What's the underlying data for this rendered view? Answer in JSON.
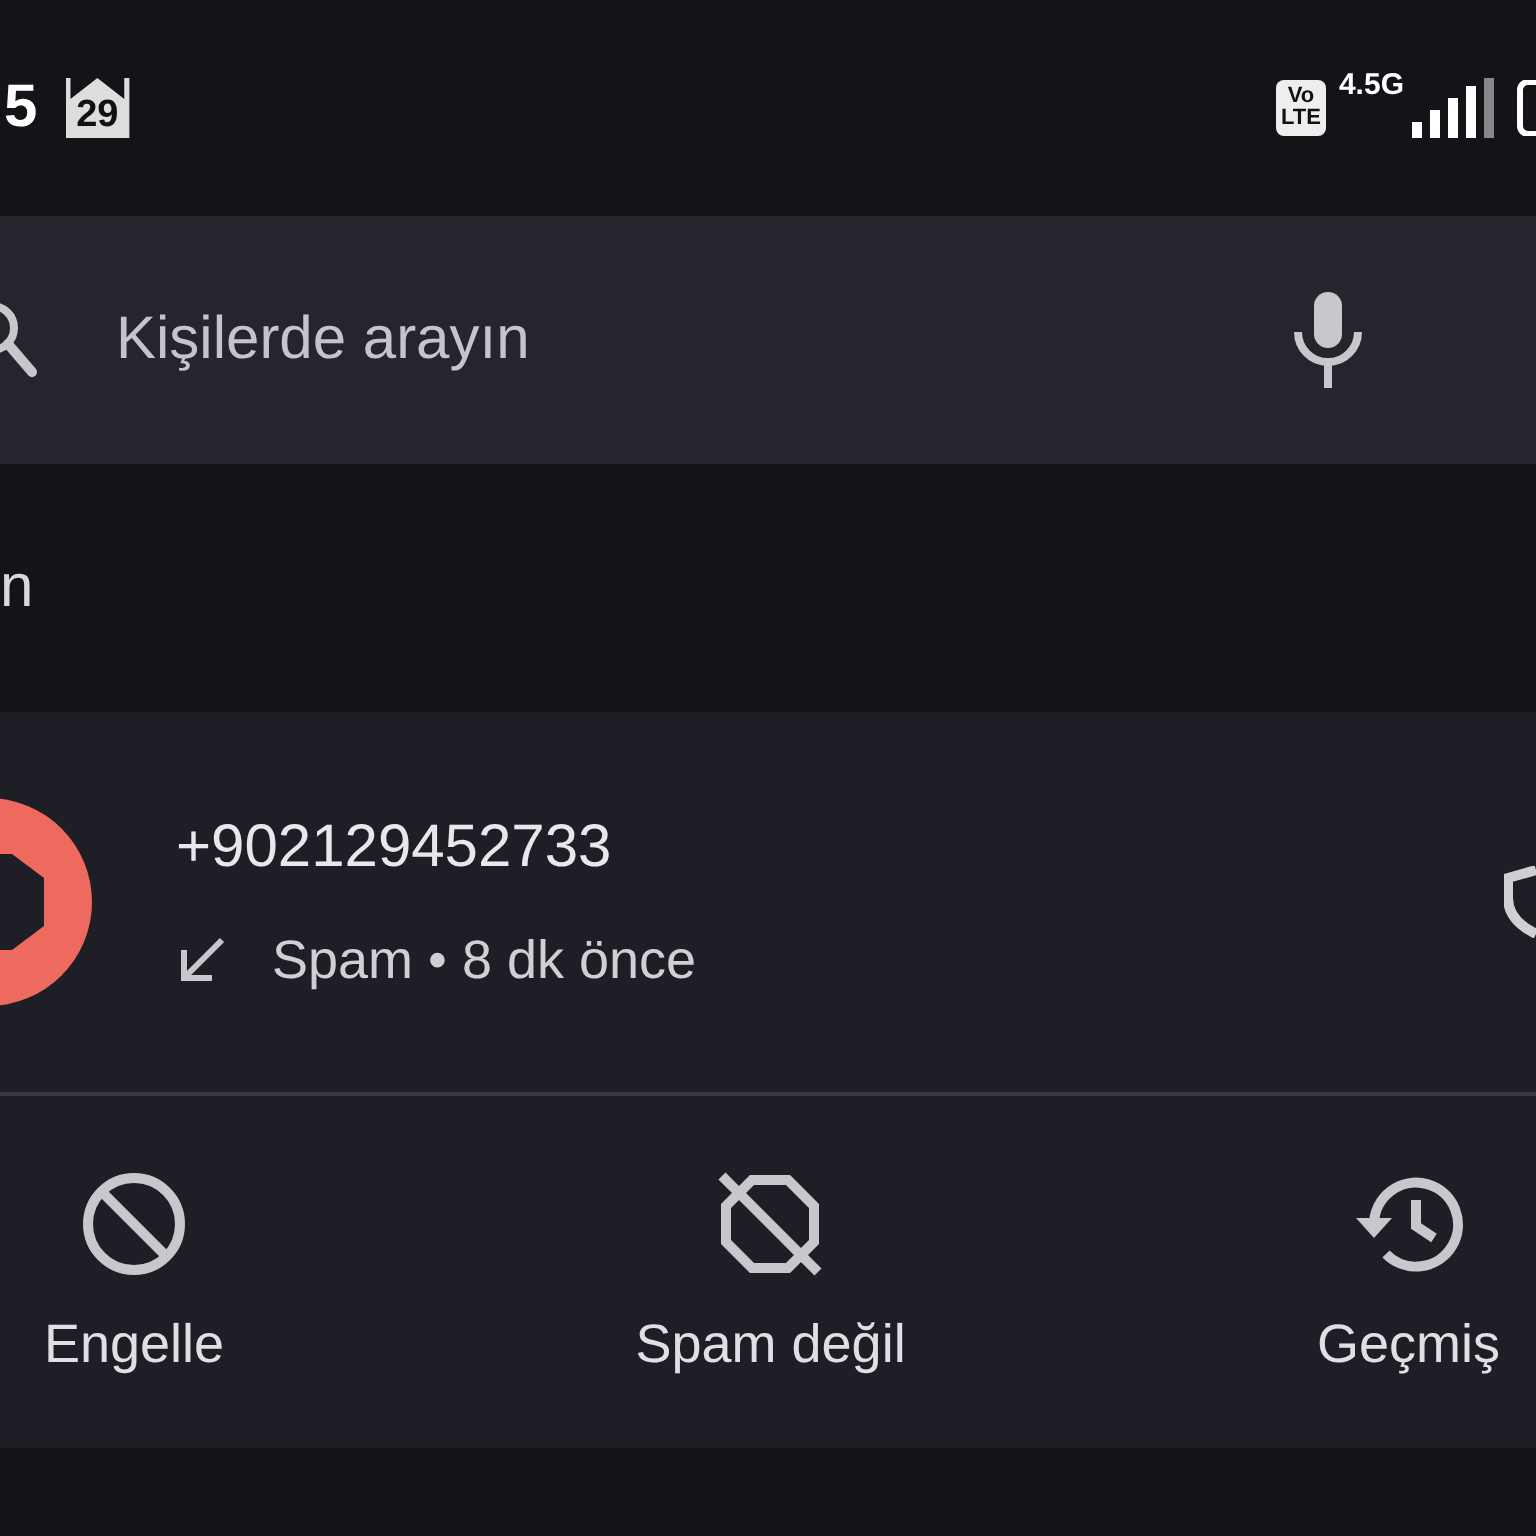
{
  "status_bar": {
    "time": "5",
    "calendar_day": "29",
    "volte": [
      "Vo",
      "LTE"
    ],
    "network": "4.5G"
  },
  "search": {
    "placeholder": "Kişilerde arayın"
  },
  "section_header": "n",
  "call": {
    "number": "+902129452733",
    "kind": "incoming",
    "detail": "Spam • 8 dk önce"
  },
  "actions": [
    {
      "kind": "block",
      "label": "Engelle"
    },
    {
      "kind": "not-spam",
      "label": "Spam değil"
    },
    {
      "kind": "history",
      "label": "Geçmiş"
    }
  ]
}
